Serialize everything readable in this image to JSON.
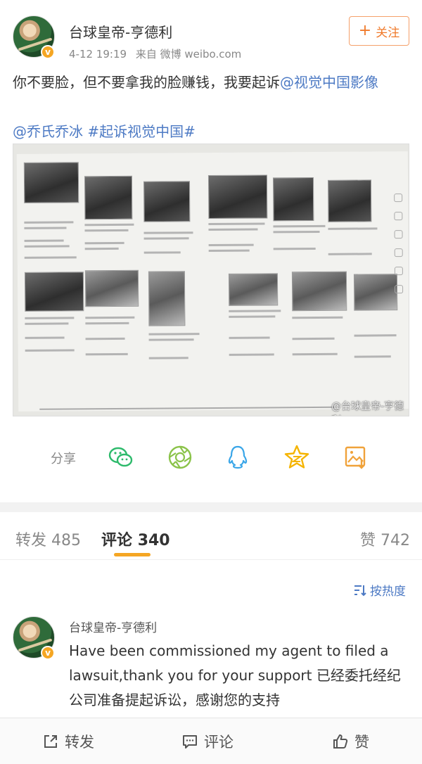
{
  "post": {
    "username": "台球皇帝-亨德利",
    "verified_badge": "v",
    "time": "4-12 19:19",
    "source": "来自 微博 weibo.com",
    "follow_label": "关注",
    "text_main": "你不要脸，但不要拿我的脸赚钱，我要起诉",
    "mention_1": "@视觉中国影像",
    "tag_mention": "@乔氏乔冰",
    "hashtag": "#起诉视觉中国#",
    "image_watermark": "@台球皇帝-亨德利"
  },
  "share": {
    "label": "分享",
    "icons": [
      "wechat-icon",
      "moments-icon",
      "qq-icon",
      "qzone-icon",
      "save-image-icon"
    ]
  },
  "tabs": {
    "repost_label": "转发",
    "repost_count": "485",
    "comment_label": "评论",
    "comment_count": "340",
    "like_label": "赞",
    "like_count": "742"
  },
  "sort": {
    "label": "按热度"
  },
  "comment": {
    "username": "台球皇帝-亨德利",
    "text": "Have been commissioned my agent to filed a lawsuit,thank you for your support 已经委托经纪公司准备提起诉讼，感谢您的支持"
  },
  "bottom_bar": {
    "repost": "转发",
    "comment": "评论",
    "like": "赞"
  },
  "colors": {
    "accent_orange": "#f07a2b",
    "link_blue": "#4d7ac4",
    "tab_underline": "#f5a623"
  }
}
